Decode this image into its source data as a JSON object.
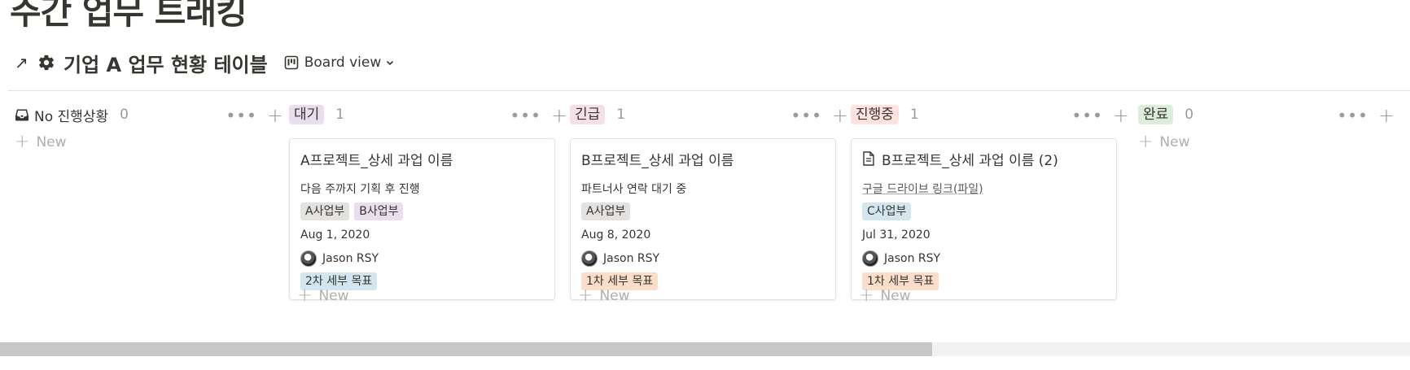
{
  "page": {
    "title": "주간 업무 트래킹"
  },
  "database": {
    "link_arrow": "↗",
    "title": "기업 A 업무 현황 테이블",
    "view_label": "Board view"
  },
  "columns": [
    {
      "name": "No 진행상황",
      "count": "0",
      "color": ""
    },
    {
      "name": "대기",
      "count": "1",
      "color": "#e8deee"
    },
    {
      "name": "긴급",
      "count": "1",
      "color": "#f5e0e9"
    },
    {
      "name": "진행중",
      "count": "1",
      "color": "#ffe2dd"
    },
    {
      "name": "완료",
      "count": "0",
      "color": "#dbeddb"
    }
  ],
  "cards": [
    {
      "title": "A프로젝트_상세 과업 이름",
      "note": "다음 주까지 기획 후 진행",
      "tags": [
        {
          "label": "A사업부",
          "color": "#e3e2e0"
        },
        {
          "label": "B사업부",
          "color": "#e8deee"
        }
      ],
      "date": "Aug 1, 2020",
      "person": "Jason RSY",
      "goal": {
        "label": "2차 세부 목표",
        "color": "#d3e5ef"
      }
    },
    {
      "title": "B프로젝트_상세 과업 이름",
      "note": "파트너사 연락 대기 중",
      "tags": [
        {
          "label": "A사업부",
          "color": "#e3e2e0"
        }
      ],
      "date": "Aug 8, 2020",
      "person": "Jason RSY",
      "goal": {
        "label": "1차 세부 목표",
        "color": "#fadec9"
      }
    },
    {
      "title": "B프로젝트_상세 과업 이름 (2)",
      "note": "구글 드라이브 링크(파일)",
      "tags": [
        {
          "label": "C사업부",
          "color": "#d3e5ef"
        }
      ],
      "date": "Jul 31, 2020",
      "person": "Jason RSY",
      "goal": {
        "label": "1차 세부 목표",
        "color": "#fadec9"
      }
    }
  ],
  "new_label": "New",
  "icons": {
    "more": "ellipsis-icon",
    "add": "plus-icon",
    "settings": "gear-icon",
    "board": "board-icon",
    "inbox": "inbox-icon",
    "page": "page-icon"
  }
}
